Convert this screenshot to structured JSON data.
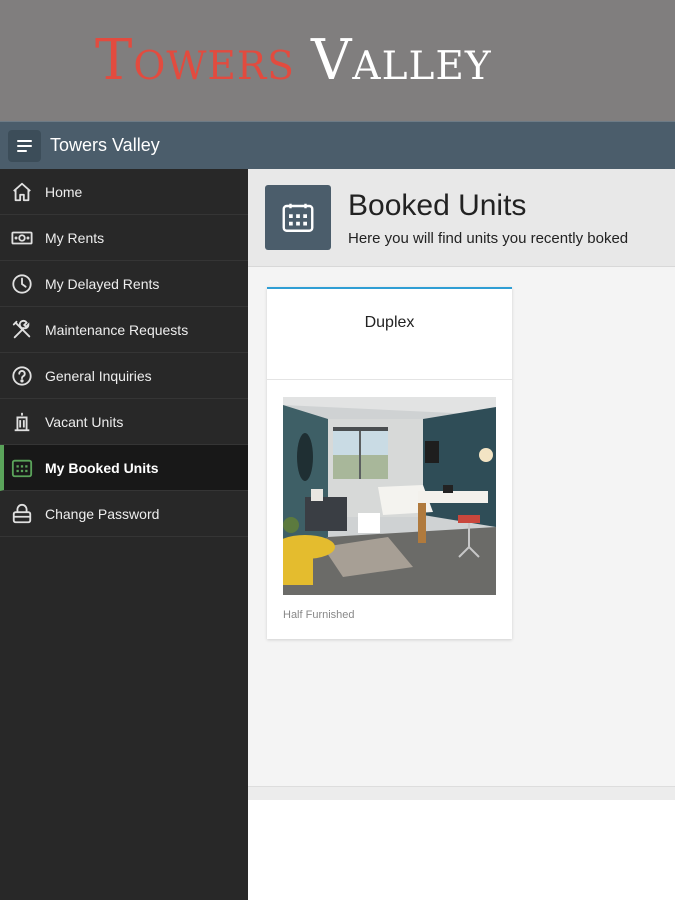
{
  "banner": {
    "logo_word1": "Towers",
    "logo_word2": "Valley"
  },
  "topbar": {
    "title": "Towers Valley",
    "menu_icon": "menu-icon"
  },
  "sidebar": {
    "items": [
      {
        "label": "Home",
        "icon": "home-icon"
      },
      {
        "label": "My Rents",
        "icon": "money-icon"
      },
      {
        "label": "My Delayed Rents",
        "icon": "clock-icon"
      },
      {
        "label": "Maintenance Requests",
        "icon": "tools-icon"
      },
      {
        "label": "General Inquiries",
        "icon": "question-icon"
      },
      {
        "label": "Vacant Units",
        "icon": "building-icon"
      },
      {
        "label": "My Booked Units",
        "icon": "calendar-icon",
        "active": true
      },
      {
        "label": "Change Password",
        "icon": "lock-icon"
      }
    ]
  },
  "page": {
    "title": "Booked Units",
    "subtitle": "Here you will find units you recently boked",
    "header_icon": "calendar-icon"
  },
  "cards": [
    {
      "title": "Duplex",
      "caption": "Half Furnished",
      "image": "room-photo"
    }
  ],
  "colors": {
    "banner_bg": "#807e7e",
    "logo_red": "#e24b3f",
    "topbar_bg": "#4b5d6b",
    "sidebar_bg": "#282828",
    "active_accent": "#5aa35a",
    "card_accent": "#2f9ed4"
  }
}
